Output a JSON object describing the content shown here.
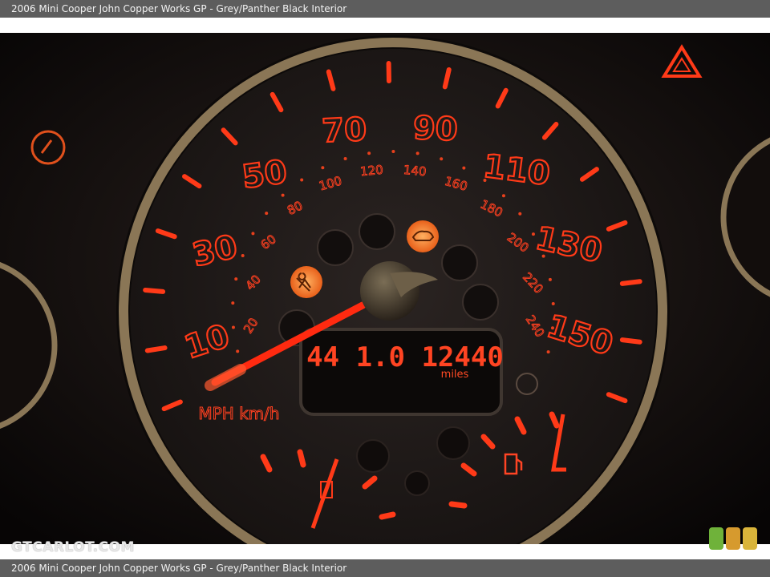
{
  "caption_top": "2006 Mini Cooper John Copper Works GP - Grey/Panther Black Interior",
  "caption_bottom": "2006 Mini Cooper John Copper Works GP - Grey/Panther Black Interior",
  "watermark": "GTCARLOT.COM",
  "gauge": {
    "mph_labels": [
      "10",
      "30",
      "50",
      "70",
      "90",
      "110",
      "130",
      "150"
    ],
    "kmh_labels": [
      "20",
      "40",
      "60",
      "80",
      "100",
      "120",
      "140",
      "160",
      "180",
      "200",
      "220",
      "240"
    ],
    "units_label": "MPH km/h",
    "odometer": "44 1.0 12440",
    "odometer_unit": "miles"
  },
  "colors": {
    "glow": "#ff3a18",
    "bezel": "#8a7656",
    "face": "#1d1817"
  },
  "badge_colors": [
    "#6fb23a",
    "#d69a2e",
    "#d9b43a"
  ]
}
